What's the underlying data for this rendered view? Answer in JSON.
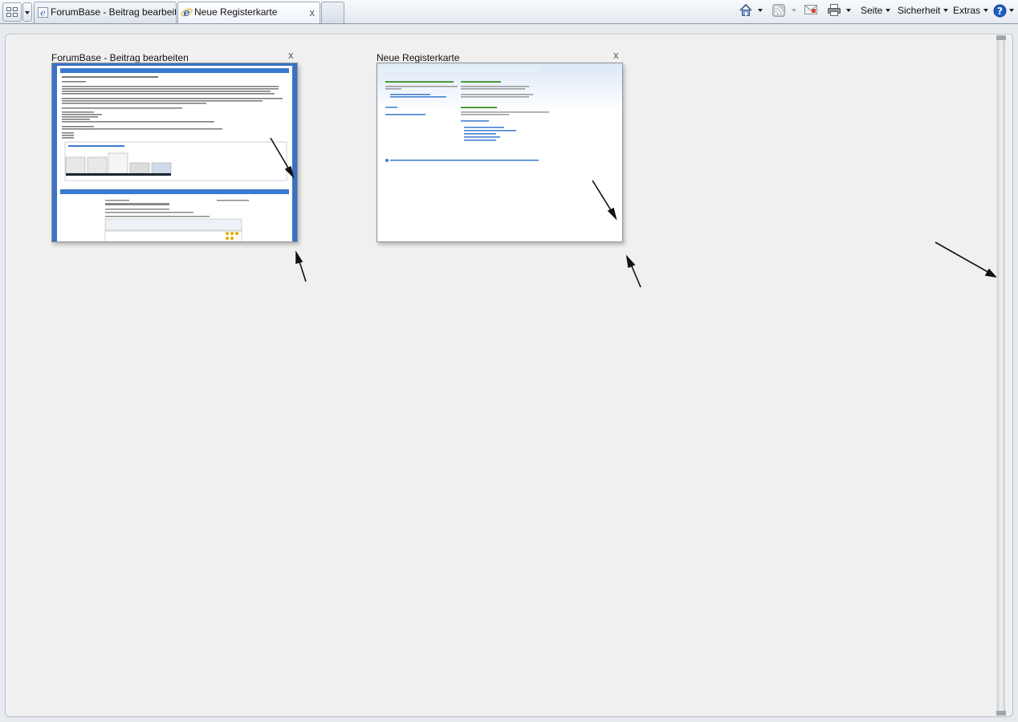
{
  "tabbar": {
    "tabs": [
      {
        "label": "ForumBase - Beitrag bearbeiten",
        "active": false
      },
      {
        "label": "Neue Registerkarte",
        "active": true,
        "close_glyph": "x"
      }
    ]
  },
  "commands": {
    "page": "Seite",
    "security": "Sicherheit",
    "tools": "Extras",
    "icons": [
      "home-icon",
      "feeds-icon",
      "read-mail-icon",
      "print-icon",
      "help-icon"
    ]
  },
  "quicktabs": {
    "thumbnails": [
      {
        "title": "ForumBase - Beitrag bearbeiten",
        "close_glyph": "x"
      },
      {
        "title": "Neue Registerkarte",
        "close_glyph": "x"
      }
    ]
  },
  "colors": {
    "accent_blue": "#3a7ad1",
    "ie_logo_blue": "#2b6fc7",
    "ie_logo_gold": "#f2b632",
    "help_blue": "#1e5ec4",
    "page_bg": "#f0f0f0"
  }
}
